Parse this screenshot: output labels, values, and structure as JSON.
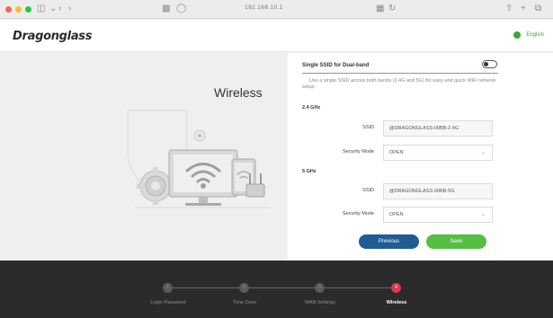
{
  "browser": {
    "url": "192.168.10.1",
    "icons": [
      "sidebar-icon",
      "back-icon",
      "forward-icon",
      "shield-icon",
      "privacy-icon",
      "translate-icon",
      "reload-icon",
      "share-icon",
      "new-tab-icon",
      "tabs-icon"
    ]
  },
  "header": {
    "brand": "Dragonglass",
    "language": "English"
  },
  "illustration": {
    "title": "Wireless"
  },
  "form": {
    "single_ssid_title": "Single SSID for Dual-band",
    "single_ssid_enabled": false,
    "description": "Use a single SSID across both bands (2.4G and 5G) for easy and quick WiFi network setup.",
    "band_24": {
      "label": "2.4 GHz",
      "ssid_label": "SSID",
      "ssid_value": "@DRAGONGLASS-00BB-2.4G",
      "security_label": "Security Mode",
      "security_value": "OPEN"
    },
    "band_5": {
      "label": "5 GHz",
      "ssid_label": "SSID",
      "ssid_value": "@DRAGONGLASS-00BB-5G",
      "security_label": "Security Mode",
      "security_value": "OPEN"
    },
    "previous_label": "Previous",
    "save_label": "Save"
  },
  "stepper": {
    "current_step": 4,
    "steps": [
      {
        "number": "1",
        "label": "Login Password"
      },
      {
        "number": "2",
        "label": "Time Zone"
      },
      {
        "number": "3",
        "label": "WAN Settings"
      },
      {
        "number": "4",
        "label": "Wireless"
      }
    ]
  },
  "colors": {
    "accent_green": "#55bf44",
    "primary_blue": "#1f5c93",
    "active_step": "#e2354f",
    "stepper_bg": "#2b2b2b"
  }
}
